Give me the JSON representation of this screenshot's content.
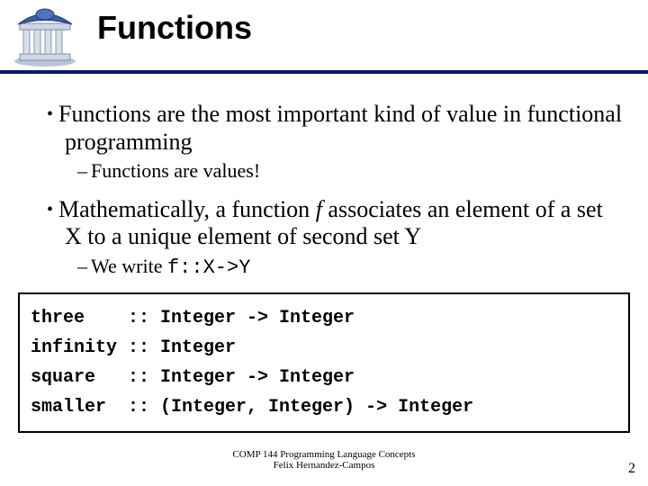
{
  "title": "Functions",
  "bullets": [
    {
      "level": 1,
      "text": "Functions are the most important kind of value in functional programming"
    },
    {
      "level": 2,
      "text": "Functions are values!"
    },
    {
      "level": 1,
      "html_parts": [
        "Mathematically, a function ",
        "f",
        " associates an element of a set X to a unique element of second set Y"
      ]
    },
    {
      "level": 2,
      "html_parts": [
        "We write ",
        "f::X->Y"
      ]
    }
  ],
  "code_lines": [
    "three    :: Integer -> Integer",
    "infinity :: Integer",
    "square   :: Integer -> Integer",
    "smaller  :: (Integer, Integer) -> Integer"
  ],
  "footer": {
    "line1": "COMP 144 Programming Language Concepts",
    "line2": "Felix Hernandez-Campos"
  },
  "page_number": "2"
}
